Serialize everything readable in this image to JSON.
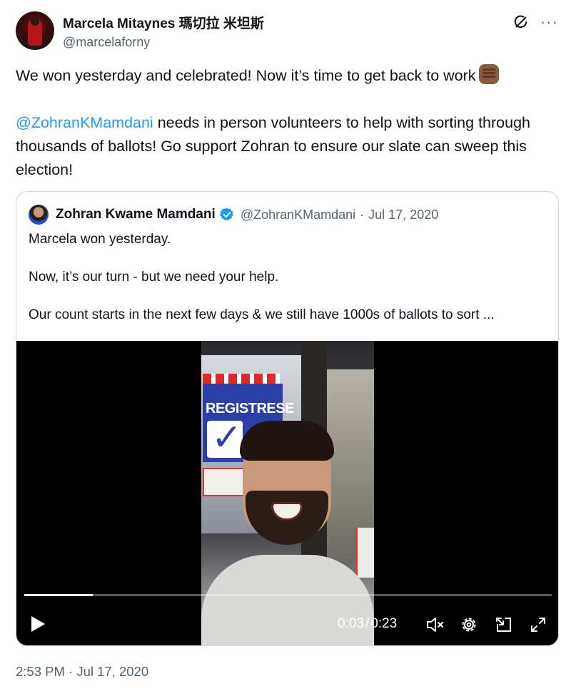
{
  "author": {
    "name": "Marcela Mitaynes 瑪切拉 米坦斯",
    "handle": "@marcelaforny",
    "avatar_icon": "profile-photo"
  },
  "header_icons": [
    "grok-icon",
    "more-icon"
  ],
  "more_label": "···",
  "tweet": {
    "line1": "We won yesterday and celebrated! Now it’s time to get back to work",
    "line1_emoji": "raised-fist-medium-dark-skin-tone",
    "mention": "@ZohranKMamdani",
    "line2_rest": " needs in person volunteers to help with sorting through thousands of ballots! Go support Zohran to ensure our slate can sweep this election!"
  },
  "quote": {
    "name": "Zohran Kwame Mamdani",
    "verified": true,
    "handle": "@ZohranKMamdani",
    "separator": "·",
    "date": "Jul 17, 2020",
    "paragraphs": [
      "Marcela won yesterday.",
      "Now, it’s our turn - but we need your help.",
      "Our count starts in the next few days & we still have 1000s of ballots to sort ..."
    ],
    "video": {
      "poster_text": "REGISTRESE",
      "progress_fraction": 0.13,
      "current_time": "0:03",
      "time_separator": "/",
      "duration": "0:23",
      "controls": [
        "play-icon",
        "mute-icon",
        "settings-icon",
        "pip-icon",
        "fullscreen-icon"
      ]
    }
  },
  "timestamp": "2:53 PM · Jul 17, 2020",
  "colors": {
    "link": "#1d9bf0",
    "secondary_text": "#536471",
    "border": "#cfd9de",
    "verified": "#1d9bf0"
  }
}
